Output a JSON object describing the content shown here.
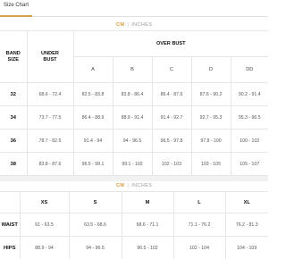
{
  "tab": {
    "label": "Size Chart"
  },
  "bust_chart": {
    "units": {
      "cm": "CM",
      "separator": "|",
      "inches": "INCHES"
    },
    "headers": {
      "band_size": "BAND SIZE",
      "under_bust": "UNDER BUST",
      "over_bust": "OVER BUST"
    },
    "cups": [
      "A",
      "B",
      "C",
      "D",
      "DD"
    ],
    "rows": [
      {
        "band": "32",
        "under": "68.6 - 72.4",
        "cups": [
          "82.5 - 83.8",
          "83.8 - 86.4",
          "86.4 - 87.6",
          "87.6 - 90.2",
          "90.2 - 91.4"
        ]
      },
      {
        "band": "34",
        "under": "73.7 - 77.5",
        "cups": [
          "86.4 - 88.9",
          "88.9 - 91.4",
          "91.4 - 92.7",
          "92.7 - 95.3",
          "95.3 - 96.5"
        ]
      },
      {
        "band": "36",
        "under": "78.7 - 82.5",
        "cups": [
          "91.4 - 94",
          "94 - 96.5",
          "96.5 - 97.8",
          "97.8 - 100",
          "100 - 102"
        ]
      },
      {
        "band": "38",
        "under": "83.8 - 87.6",
        "cups": [
          "96.5 - 99.1",
          "99.1 - 102",
          "102 - 103",
          "103 - 105",
          "105 - 107"
        ]
      }
    ]
  },
  "size_chart": {
    "units": {
      "cm": "CM",
      "separator": "|",
      "inches": "INCHES"
    },
    "sizes": [
      "XS",
      "S",
      "M",
      "L",
      "XL"
    ],
    "rows": [
      {
        "label": "WAIST",
        "values": [
          "61 - 63.5",
          "63.5 - 68.6",
          "68.6 - 71.1",
          "71.1 - 76.2",
          "76.2 - 81.3"
        ]
      },
      {
        "label": "HIPS",
        "values": [
          "88.9 - 94",
          "94 - 96.5",
          "96.5 - 102",
          "102 - 104",
          "104 - 109"
        ]
      }
    ]
  },
  "colors": {
    "accent": "#d89a3a",
    "tab_underline": "#cfa24a",
    "grid_line": "#e6e6e6"
  }
}
